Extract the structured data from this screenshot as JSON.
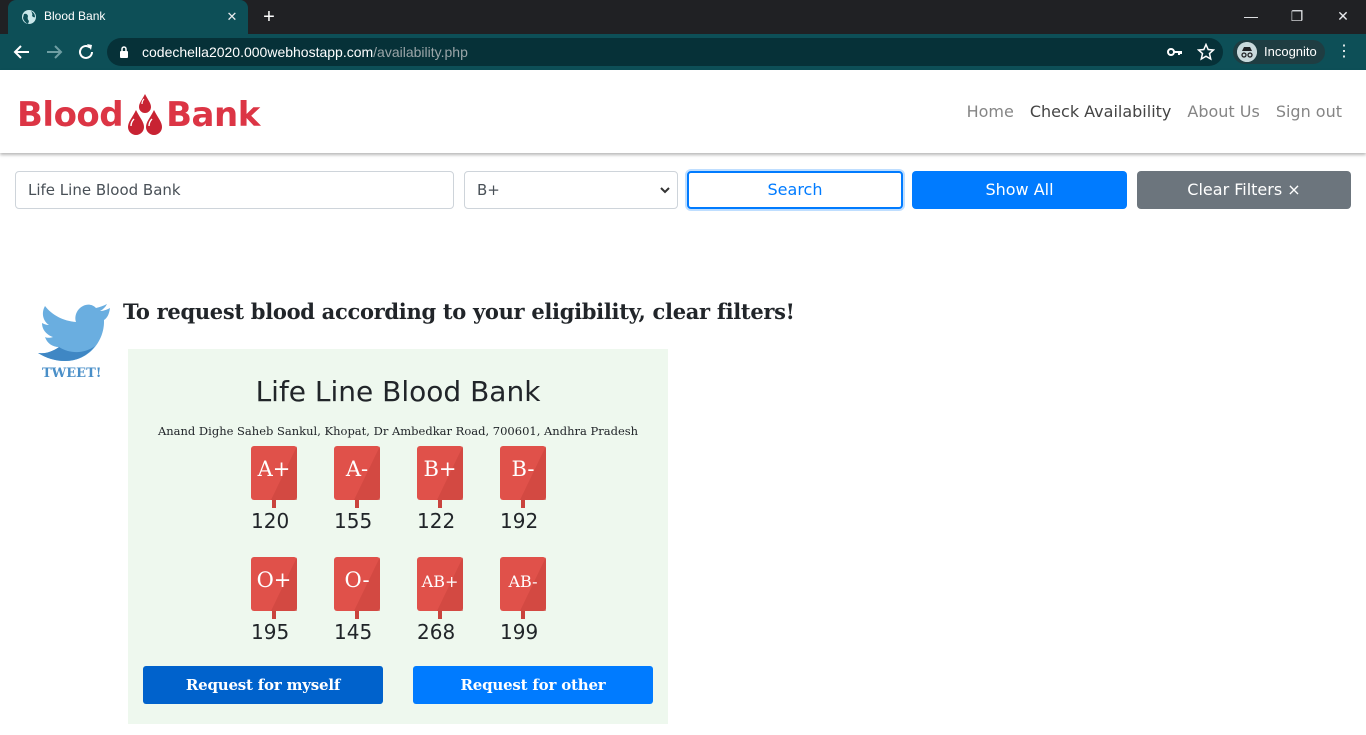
{
  "browser": {
    "tab_title": "Blood Bank",
    "tab_close": "✕",
    "new_tab": "+",
    "url_host": "codechella2020.000webhostapp.com",
    "url_path": "/availability.php",
    "incognito_label": "Incognito",
    "window_minimize": "—",
    "window_restore": "❐",
    "window_close": "✕",
    "menu": "⋮"
  },
  "brand": {
    "word1": "Blood",
    "word2": "Bank",
    "color": "#dc3545"
  },
  "nav": {
    "items": [
      {
        "label": "Home"
      },
      {
        "label": "Check Availability"
      },
      {
        "label": "About Us"
      },
      {
        "label": "Sign out"
      }
    ]
  },
  "filters": {
    "bank_name_value": "Life Line Blood Bank",
    "blood_group_selected": "B+",
    "search_label": "Search",
    "show_all_label": "Show All",
    "clear_label": "Clear Filters ×"
  },
  "tweet_label": "TWEET!",
  "notice": "To request blood according to your eligibility, clear filters!",
  "card": {
    "name": "Life Line Blood Bank",
    "address": "Anand Dighe Saheb Sankul, Khopat, Dr Ambedkar Road, 700601, Andhra Pradesh",
    "groups": [
      {
        "group": "A+",
        "count": "120"
      },
      {
        "group": "A-",
        "count": "155"
      },
      {
        "group": "B+",
        "count": "122"
      },
      {
        "group": "B-",
        "count": "192"
      },
      {
        "group": "O+",
        "count": "195"
      },
      {
        "group": "O-",
        "count": "145"
      },
      {
        "group": "AB+",
        "count": "268"
      },
      {
        "group": "AB-",
        "count": "199"
      }
    ],
    "request_self_label": "Request for myself",
    "request_other_label": "Request for other"
  },
  "colors": {
    "chrome_teal": "#0d4f57",
    "primary": "#007bff",
    "secondary": "#6c757d",
    "bag_red": "#e0514a",
    "card_bg": "#eef8ee"
  }
}
